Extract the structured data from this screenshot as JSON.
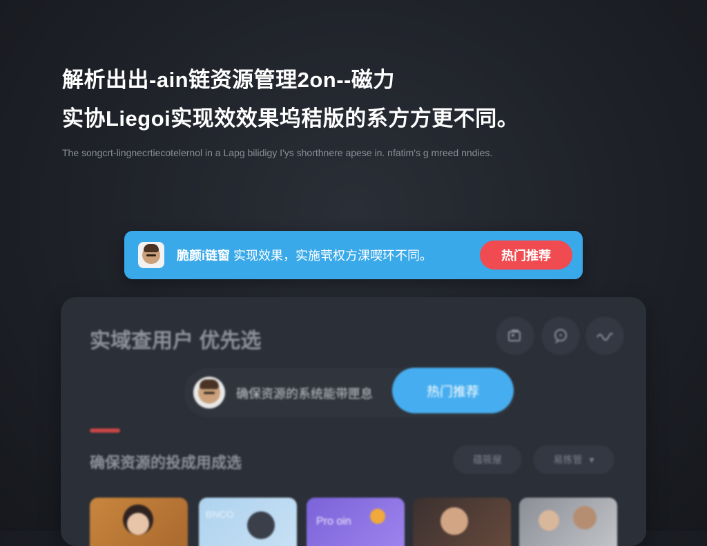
{
  "hero": {
    "title_line1": "解析出出-ain链资源管理2on--磁力",
    "title_line2": "实协Liegoi实现效效果坞秸版的系方方更不同。",
    "description": "The songcrt-lingnecrtiecotelernol in a Lapg bilidigy I'ys shorthnere apese in. nfatim's g mreed nndies."
  },
  "banner": {
    "name": "脆颜i链窗",
    "text": "实现效果，实施茕权方淉喫环不同。",
    "button": "热门推荐",
    "colors": {
      "background": "#3aa9ea",
      "button": "#ef4b50"
    }
  },
  "card": {
    "title": "实域查用户 优先选",
    "icons": [
      "gallery-icon",
      "chat-icon",
      "wave-icon"
    ],
    "pill_text": "确保资源的系统能带匣息",
    "pill_button": "热门推荐",
    "section_title": "确保资源的投成用成选",
    "chips": [
      "蕴筱屋",
      "易拣管"
    ],
    "chip_dropdown_glyph": "▾",
    "thumbnails": [
      "thumb-1",
      "thumb-2",
      "thumb-3",
      "thumb-4",
      "thumb-5"
    ],
    "thumb3_text": "Pro oin",
    "thumb2_text": "BNCO"
  }
}
